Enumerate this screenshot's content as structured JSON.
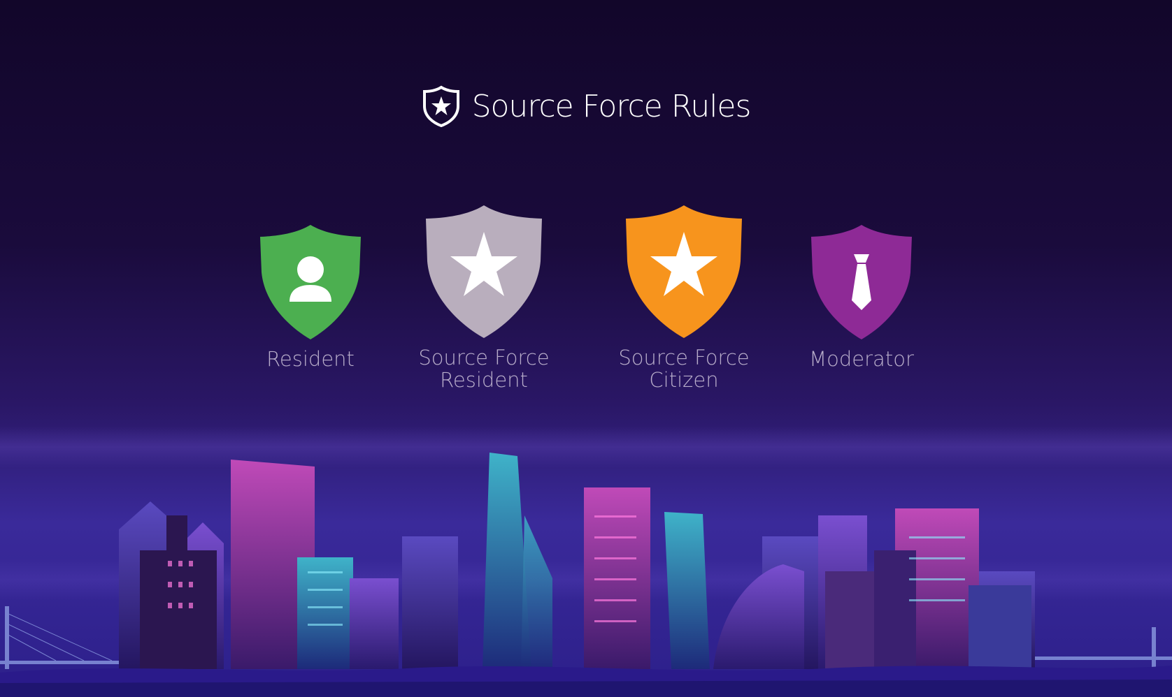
{
  "header": {
    "title": "Source Force Rules",
    "icon": "shield-star-icon"
  },
  "badges": [
    {
      "label_lines": [
        "Resident"
      ],
      "color": "#4caf50",
      "icon": "person-icon"
    },
    {
      "label_lines": [
        "Source Force",
        "Resident"
      ],
      "color": "#b9aebd",
      "icon": "star-icon"
    },
    {
      "label_lines": [
        "Source Force",
        "Citizen"
      ],
      "color": "#f7941d",
      "icon": "star-icon"
    },
    {
      "label_lines": [
        "Moderator"
      ],
      "color": "#8e2a96",
      "icon": "tie-icon"
    }
  ],
  "colors": {
    "background_top": "#12062a",
    "background_bottom": "#2c1f8a",
    "label_text": "#b9aecb"
  }
}
